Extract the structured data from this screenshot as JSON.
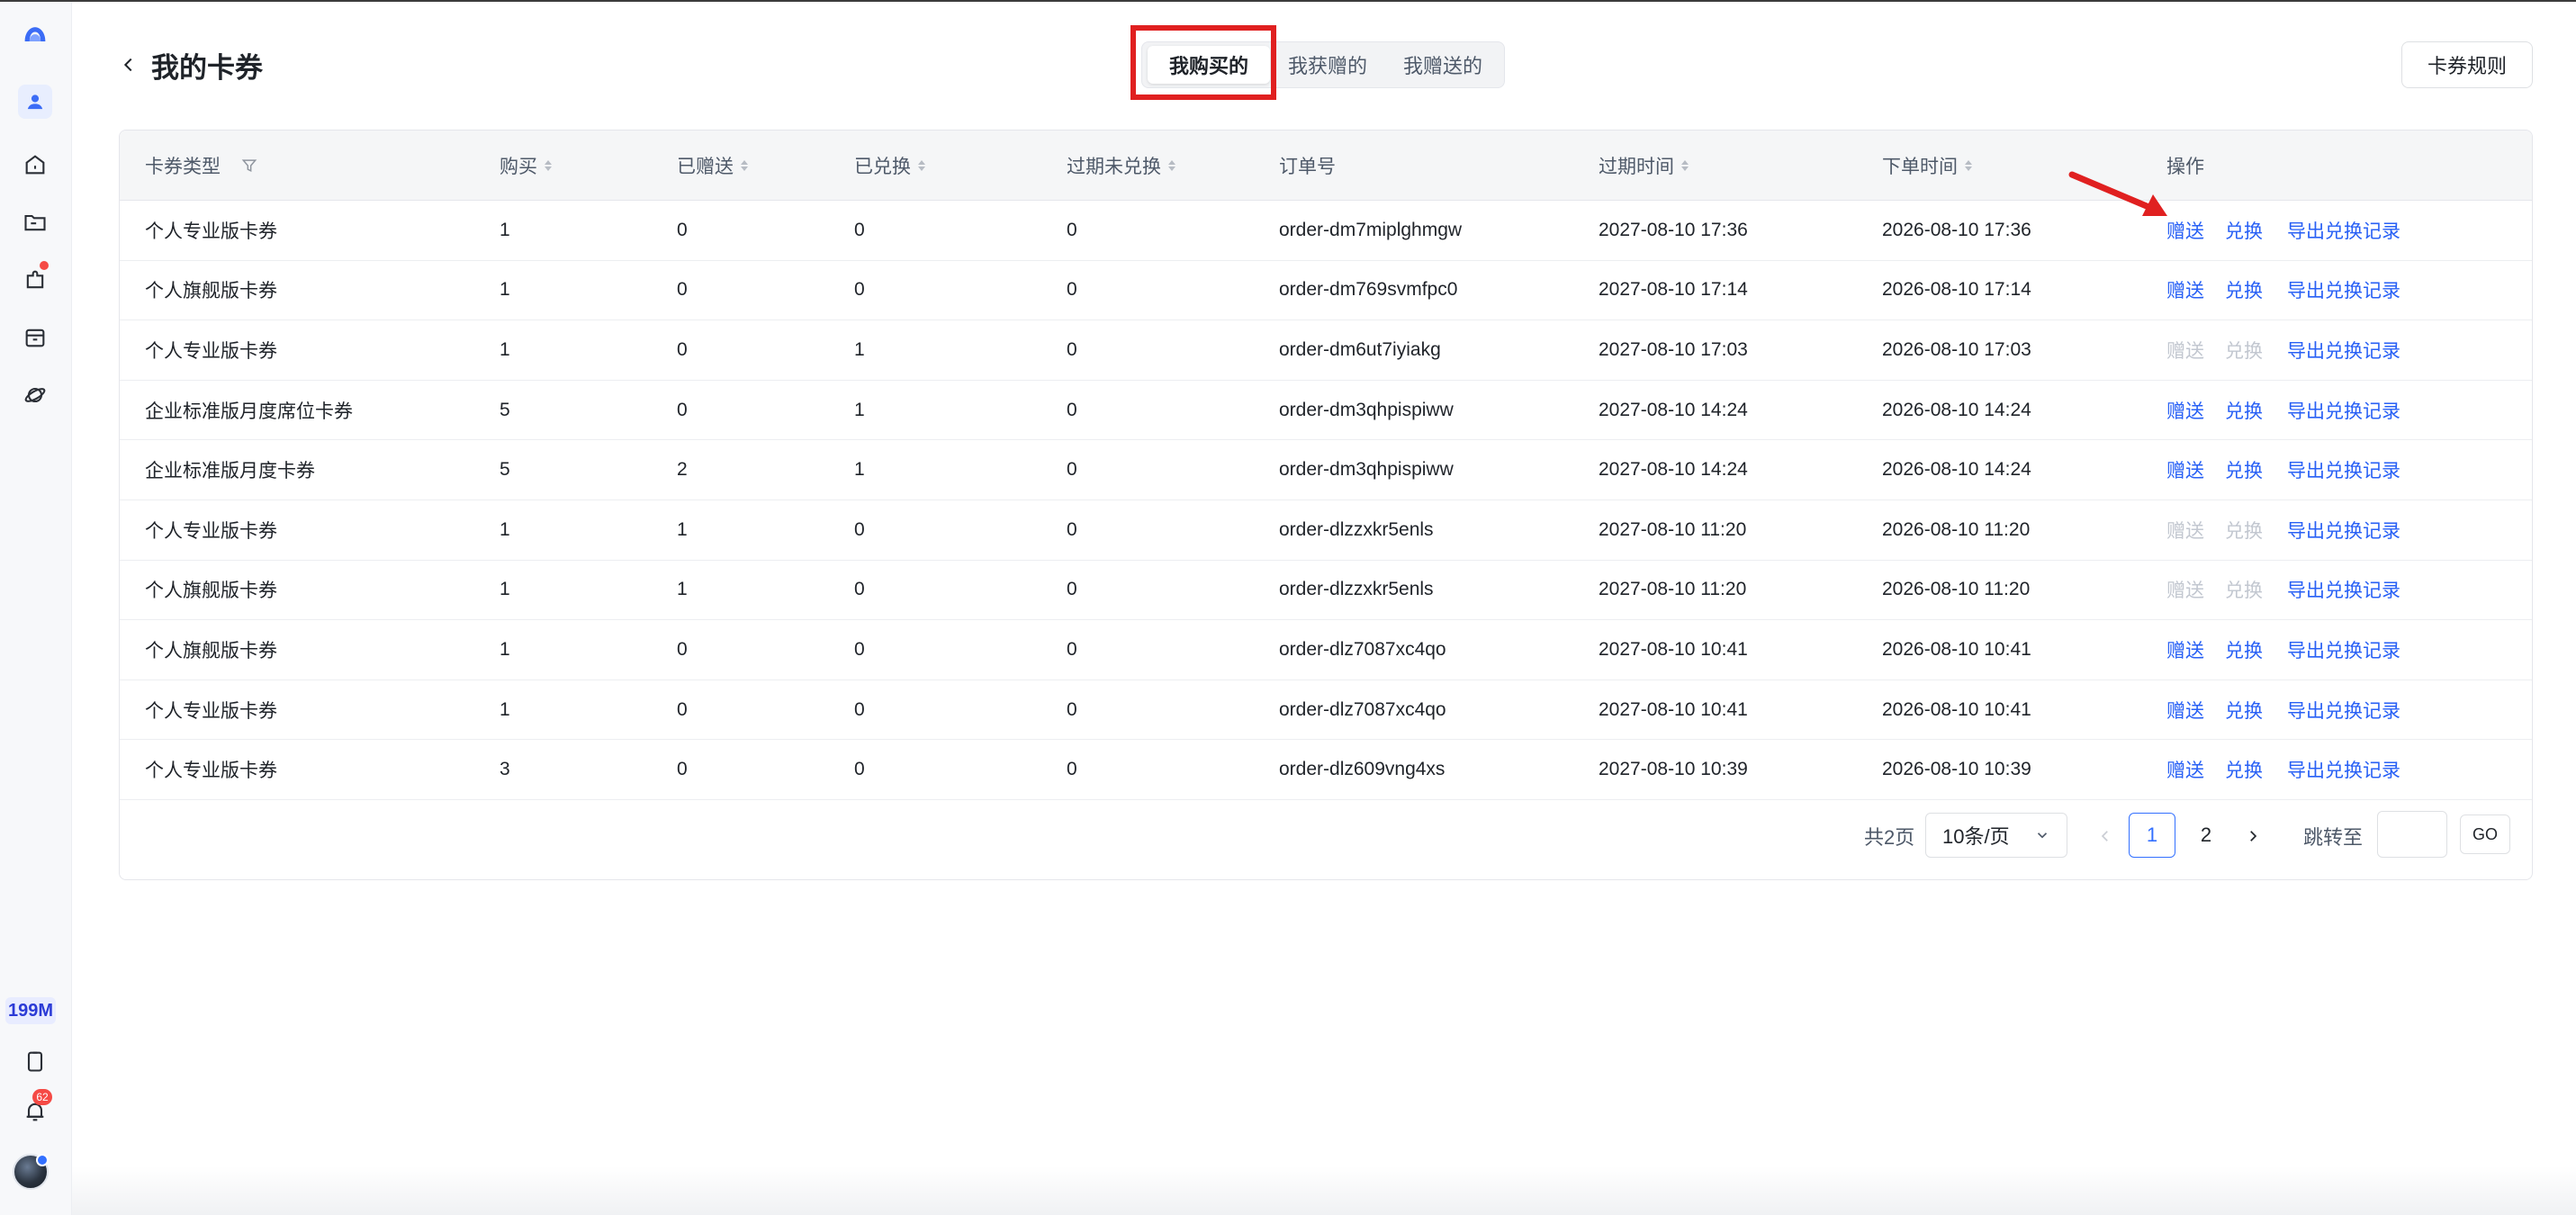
{
  "sidebar": {
    "storage_label": "199M",
    "notification_count": "62",
    "icons": [
      "logo-icon",
      "user-icon",
      "home-icon",
      "folder-icon",
      "plugin-icon",
      "archive-icon",
      "planet-icon",
      "clipboard-icon",
      "bell-icon"
    ]
  },
  "header": {
    "title": "我的卡券",
    "tabs": [
      {
        "label": "我购买的",
        "active": true
      },
      {
        "label": "我获赠的",
        "active": false
      },
      {
        "label": "我赠送的",
        "active": false
      }
    ],
    "rules_button": "卡券规则"
  },
  "table": {
    "columns": [
      "卡券类型",
      "购买",
      "已赠送",
      "已兑换",
      "过期未兑换",
      "订单号",
      "过期时间",
      "下单时间",
      "操作"
    ],
    "actions": {
      "gift": "赠送",
      "redeem": "兑换",
      "export": "导出兑换记录"
    },
    "rows": [
      {
        "type": "个人专业版卡券",
        "bought": "1",
        "gifted": "0",
        "redeemed": "0",
        "expired": "0",
        "order": "order-dm7miplghmgw",
        "expire_time": "2027-08-10 17:36",
        "order_time": "2026-08-10 17:36",
        "actions_enabled": true
      },
      {
        "type": "个人旗舰版卡券",
        "bought": "1",
        "gifted": "0",
        "redeemed": "0",
        "expired": "0",
        "order": "order-dm769svmfpc0",
        "expire_time": "2027-08-10 17:14",
        "order_time": "2026-08-10 17:14",
        "actions_enabled": true
      },
      {
        "type": "个人专业版卡券",
        "bought": "1",
        "gifted": "0",
        "redeemed": "1",
        "expired": "0",
        "order": "order-dm6ut7iyiakg",
        "expire_time": "2027-08-10 17:03",
        "order_time": "2026-08-10 17:03",
        "actions_enabled": false
      },
      {
        "type": "企业标准版月度席位卡券",
        "bought": "5",
        "gifted": "0",
        "redeemed": "1",
        "expired": "0",
        "order": "order-dm3qhpispiww",
        "expire_time": "2027-08-10 14:24",
        "order_time": "2026-08-10 14:24",
        "actions_enabled": true
      },
      {
        "type": "企业标准版月度卡券",
        "bought": "5",
        "gifted": "2",
        "redeemed": "1",
        "expired": "0",
        "order": "order-dm3qhpispiww",
        "expire_time": "2027-08-10 14:24",
        "order_time": "2026-08-10 14:24",
        "actions_enabled": true
      },
      {
        "type": "个人专业版卡券",
        "bought": "1",
        "gifted": "1",
        "redeemed": "0",
        "expired": "0",
        "order": "order-dlzzxkr5enls",
        "expire_time": "2027-08-10 11:20",
        "order_time": "2026-08-10 11:20",
        "actions_enabled": false
      },
      {
        "type": "个人旗舰版卡券",
        "bought": "1",
        "gifted": "1",
        "redeemed": "0",
        "expired": "0",
        "order": "order-dlzzxkr5enls",
        "expire_time": "2027-08-10 11:20",
        "order_time": "2026-08-10 11:20",
        "actions_enabled": false
      },
      {
        "type": "个人旗舰版卡券",
        "bought": "1",
        "gifted": "0",
        "redeemed": "0",
        "expired": "0",
        "order": "order-dlz7087xc4qo",
        "expire_time": "2027-08-10 10:41",
        "order_time": "2026-08-10 10:41",
        "actions_enabled": true
      },
      {
        "type": "个人专业版卡券",
        "bought": "1",
        "gifted": "0",
        "redeemed": "0",
        "expired": "0",
        "order": "order-dlz7087xc4qo",
        "expire_time": "2027-08-10 10:41",
        "order_time": "2026-08-10 10:41",
        "actions_enabled": true
      },
      {
        "type": "个人专业版卡券",
        "bought": "3",
        "gifted": "0",
        "redeemed": "0",
        "expired": "0",
        "order": "order-dlz609vng4xs",
        "expire_time": "2027-08-10 10:39",
        "order_time": "2026-08-10 10:39",
        "actions_enabled": true
      }
    ]
  },
  "pagination": {
    "total_label": "共2页",
    "page_size": "10条/页",
    "pages": [
      "1",
      "2"
    ],
    "current_page": "1",
    "jump_label": "跳转至",
    "jump_value": "",
    "go_label": "GO"
  },
  "colors": {
    "accent": "#2860f5",
    "disabled": "#c2c7d0",
    "annotation_red": "#e02020"
  }
}
